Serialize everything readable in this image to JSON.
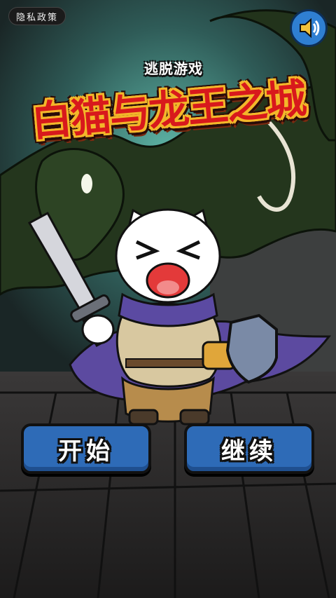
{
  "top_bar": {
    "privacy_label": "隐私政策",
    "sound_icon": "speaker-icon"
  },
  "title": {
    "subtitle": "逃脱游戏",
    "main": "白猫与龙王之城"
  },
  "buttons": {
    "start": "开始",
    "continue": "继续"
  },
  "colors": {
    "title_red": "#d8191c",
    "title_gold": "#f3b72a",
    "button_blue": "#2e6bb7",
    "sound_blue": "#2f7fd2",
    "dragon_green": "#2a3d22",
    "cape_purple": "#5c4aa0"
  }
}
